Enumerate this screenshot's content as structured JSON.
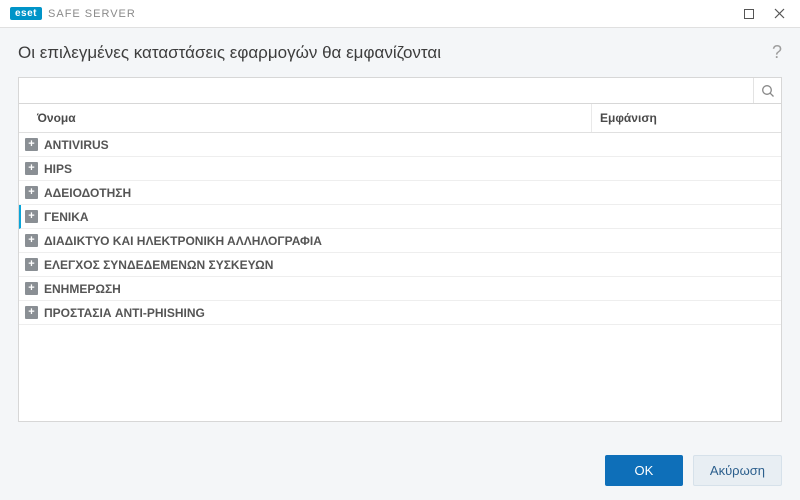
{
  "titlebar": {
    "brand_badge": "eset",
    "brand_text": "SAFE SERVER"
  },
  "header": {
    "title": "Οι επιλεγμένες καταστάσεις εφαρμογών θα εμφανίζονται"
  },
  "search": {
    "value": "",
    "placeholder": ""
  },
  "columns": {
    "name": "Όνομα",
    "show": "Εμφάνιση"
  },
  "rows": [
    {
      "label": "ANTIVIRUS",
      "highlight": false
    },
    {
      "label": "HIPS",
      "highlight": false
    },
    {
      "label": "ΑΔΕΙΟΔΟΤΗΣΗ",
      "highlight": false
    },
    {
      "label": "ΓΕΝΙΚΑ",
      "highlight": true
    },
    {
      "label": "ΔΙΑΔΙΚΤΥΟ ΚΑΙ ΗΛΕΚΤΡΟΝΙΚΗ ΑΛΛΗΛΟΓΡΑΦΙΑ",
      "highlight": false
    },
    {
      "label": "ΕΛΕΓΧΟΣ ΣΥΝΔΕΔΕΜΕΝΩΝ ΣΥΣΚΕΥΩΝ",
      "highlight": false
    },
    {
      "label": "ΕΝΗΜΕΡΩΣΗ",
      "highlight": false
    },
    {
      "label": "ΠΡΟΣΤΑΣΙΑ ANTI-PHISHING",
      "highlight": false
    }
  ],
  "footer": {
    "ok": "OK",
    "cancel": "Ακύρωση"
  },
  "glyphs": {
    "help": "?",
    "plus": "+"
  },
  "colors": {
    "accent": "#0e6fb9",
    "brand": "#0094c8",
    "highlight_bar": "#0aa5d9"
  }
}
